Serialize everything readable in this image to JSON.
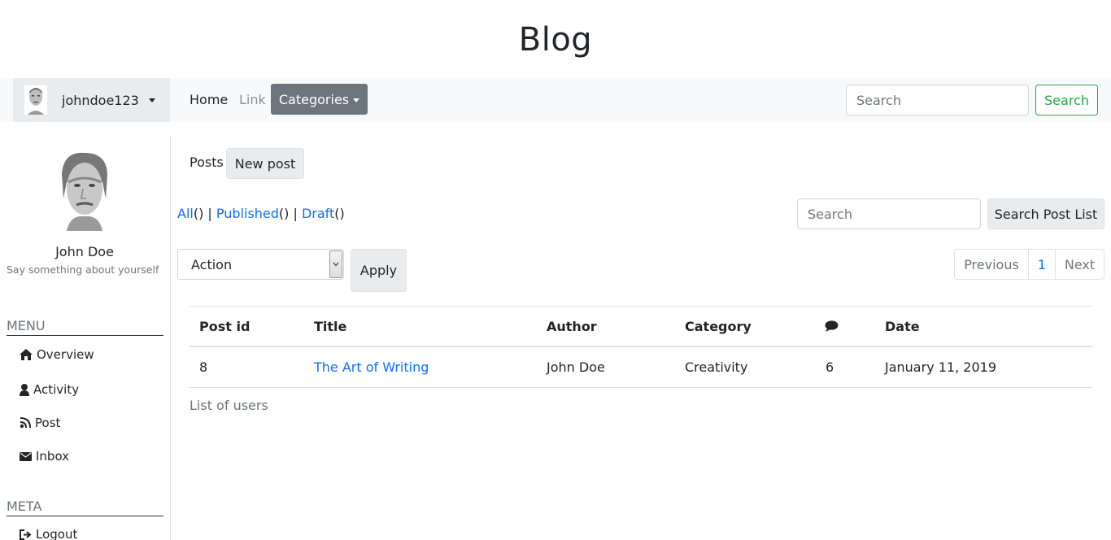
{
  "site": {
    "title": "Blog"
  },
  "navbar": {
    "username": "johndoe123",
    "home": "Home",
    "link": "Link",
    "categories": "Categories",
    "search_placeholder": "Search",
    "search_button": "Search"
  },
  "sidebar": {
    "name": "John Doe",
    "bio": "Say something about yourself",
    "menu_heading": "MENU",
    "menu": [
      {
        "label": "Overview",
        "icon": "home-icon"
      },
      {
        "label": "Activity",
        "icon": "user-icon"
      },
      {
        "label": "Post",
        "icon": "rss-icon"
      },
      {
        "label": "Inbox",
        "icon": "envelope-icon"
      }
    ],
    "meta_heading": "META",
    "meta": [
      {
        "label": "Logout",
        "icon": "sign-out-icon"
      }
    ]
  },
  "main": {
    "posts_label": "Posts",
    "new_post": "New post",
    "filters": {
      "all": "All",
      "published": "Published",
      "draft": "Draft"
    },
    "search_placeholder": "Search",
    "search_button": "Search Post List",
    "action_select": "Action",
    "apply": "Apply",
    "pagination": {
      "prev": "Previous",
      "current": "1",
      "next": "Next"
    },
    "table": {
      "headers": [
        "Post id",
        "Title",
        "Author",
        "Category",
        "comment-icon",
        "Date"
      ],
      "rows": [
        {
          "id": "8",
          "title": "The Art of Writing",
          "author": "John Doe",
          "category": "Creativity",
          "comments": "6",
          "date": "January 11, 2019"
        }
      ]
    },
    "users_label": "List of users"
  }
}
